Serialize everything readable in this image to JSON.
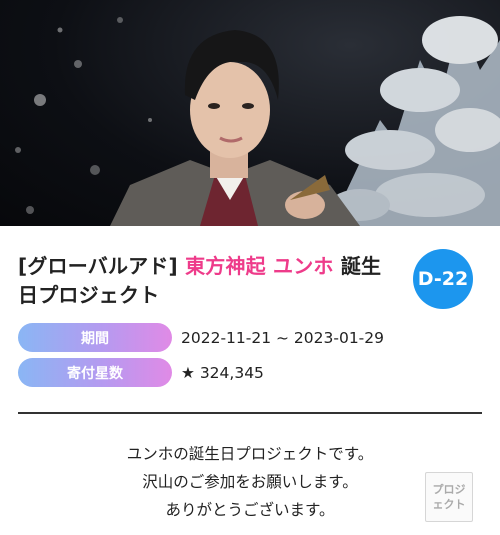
{
  "hero": {
    "image_alt": "artist photo"
  },
  "title": {
    "prefix": "[グローバルアド]",
    "artist": "東方神起 ユンホ",
    "suffix": "誕生日プロジェクト"
  },
  "dday_badge": "D-22",
  "info": {
    "period_label": "期間",
    "period_value": "2022-11-21 ~ 2023-01-29",
    "stars_label": "寄付星数",
    "stars_value": "★ 324,345"
  },
  "description": {
    "line1": "ユンホの誕生日プロジェクトです。",
    "line2": "沢山のご参加をお願いします。",
    "line3": "ありがとうございます。"
  },
  "project_button": {
    "line1": "プロジ",
    "line2": "ェクト"
  },
  "colors": {
    "accent_pink": "#ee3b8a",
    "dday_blue": "#1c96ee",
    "pill_gradient_start": "#8ab6f4",
    "pill_gradient_end": "#e08ae6"
  }
}
